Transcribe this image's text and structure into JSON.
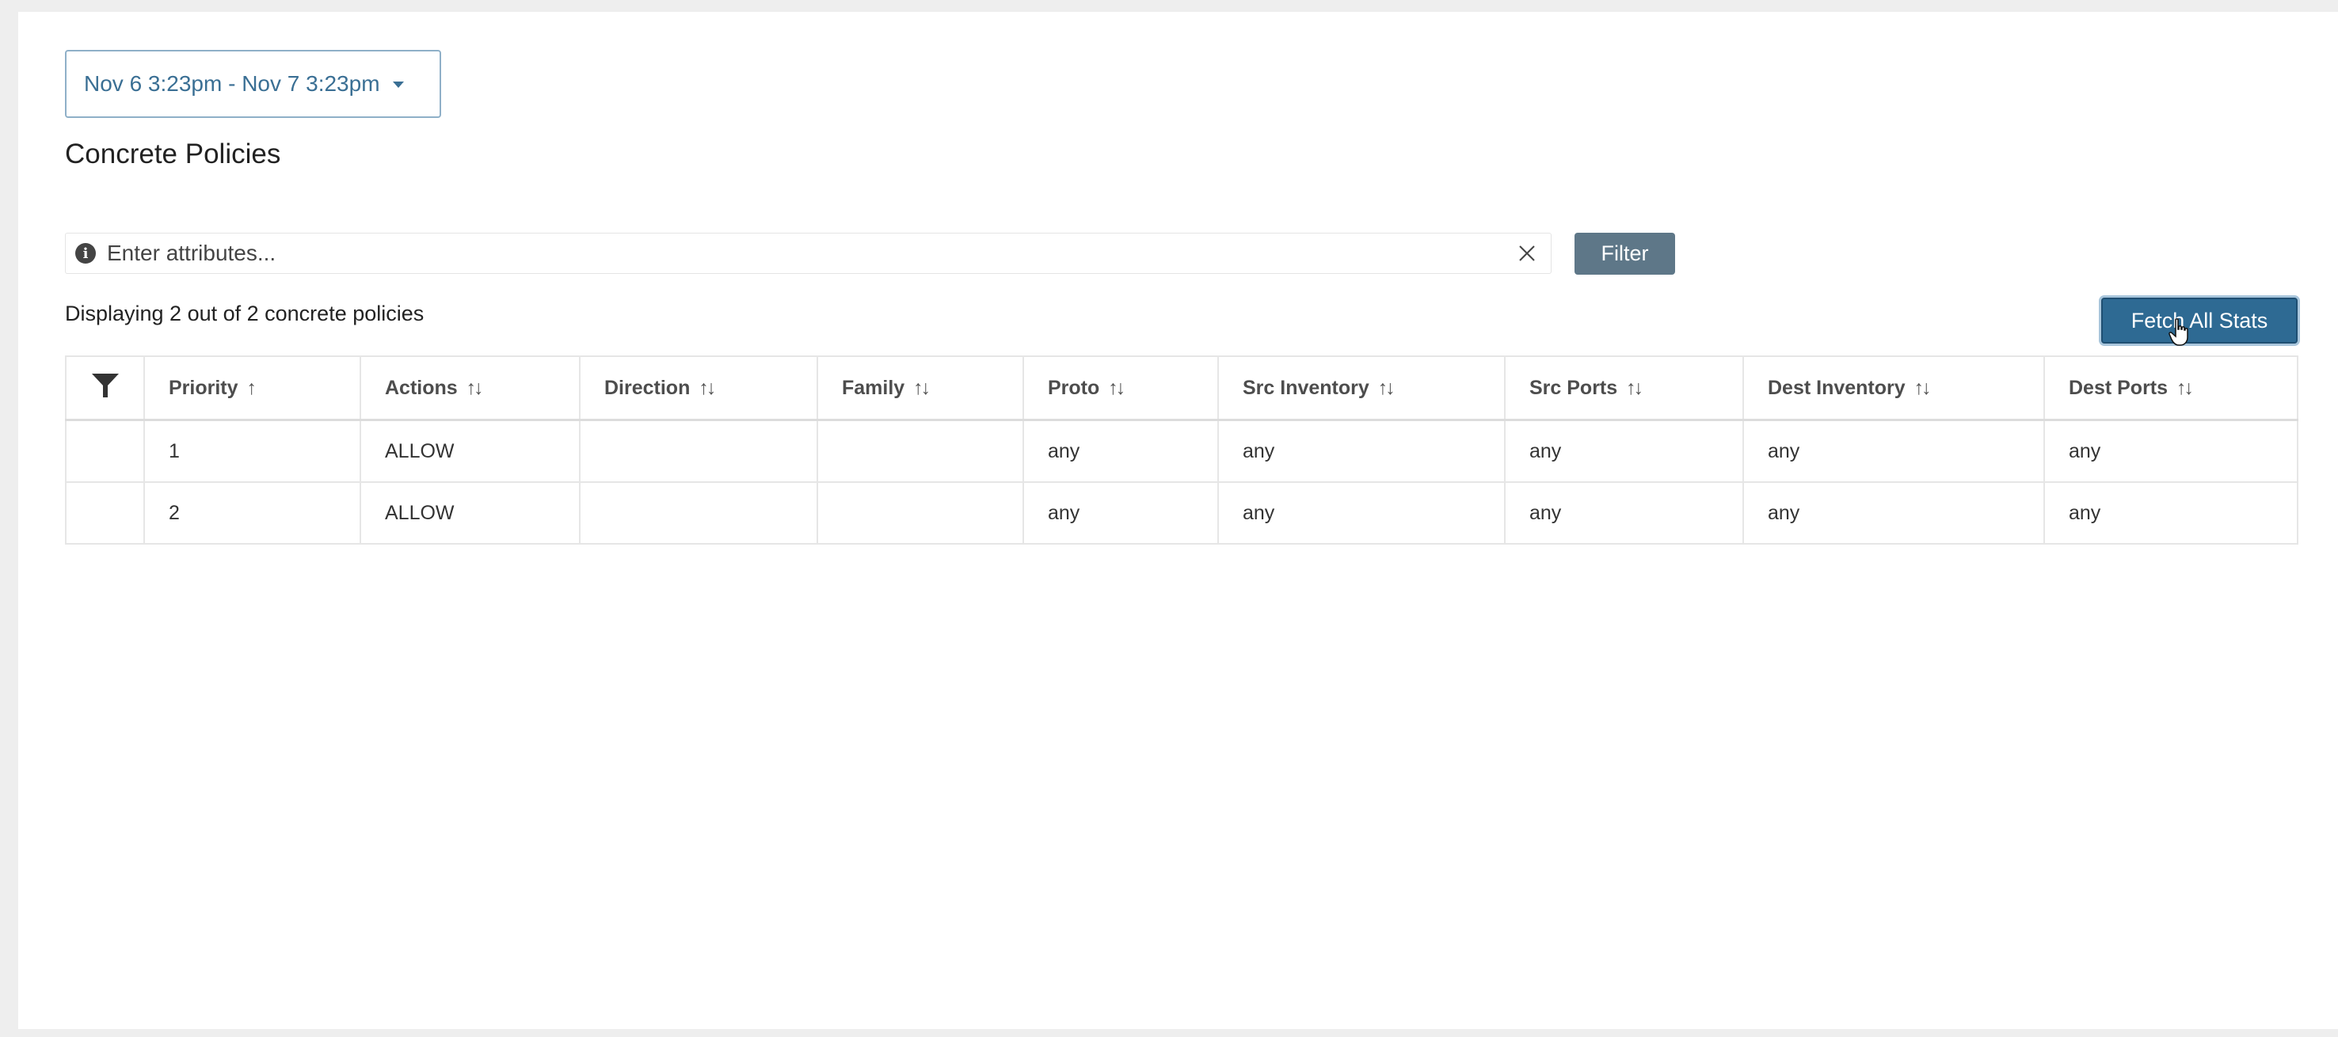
{
  "date_range": {
    "label": "Nov 6 3:23pm - Nov 7 3:23pm"
  },
  "page_title": "Concrete Policies",
  "search": {
    "placeholder": "Enter attributes...",
    "value": ""
  },
  "filter_button_label": "Filter",
  "count_text": "Displaying 2 out of 2 concrete policies",
  "fetch_button_label": "Fetch All Stats",
  "table": {
    "columns": [
      {
        "label": "Priority",
        "sort": "↑"
      },
      {
        "label": "Actions",
        "sort": "↑↓"
      },
      {
        "label": "Direction",
        "sort": "↑↓"
      },
      {
        "label": "Family",
        "sort": "↑↓"
      },
      {
        "label": "Proto",
        "sort": "↑↓"
      },
      {
        "label": "Src Inventory",
        "sort": "↑↓"
      },
      {
        "label": "Src Ports",
        "sort": "↑↓"
      },
      {
        "label": "Dest Inventory",
        "sort": "↑↓"
      },
      {
        "label": "Dest Ports",
        "sort": "↑↓"
      }
    ],
    "rows": [
      [
        "1",
        "ALLOW",
        "",
        "",
        "any",
        "any",
        "any",
        "any",
        "any"
      ],
      [
        "2",
        "ALLOW",
        "",
        "",
        "any",
        "any",
        "any",
        "any",
        "any"
      ]
    ]
  },
  "icons": {
    "info": "info-icon",
    "clear": "close-icon",
    "column_filter": "funnel-icon",
    "caret": "chevron-down-icon"
  },
  "colors": {
    "primary_button": "#2e6a93",
    "filter_button": "#5e7788",
    "link_text": "#3a6f94"
  }
}
